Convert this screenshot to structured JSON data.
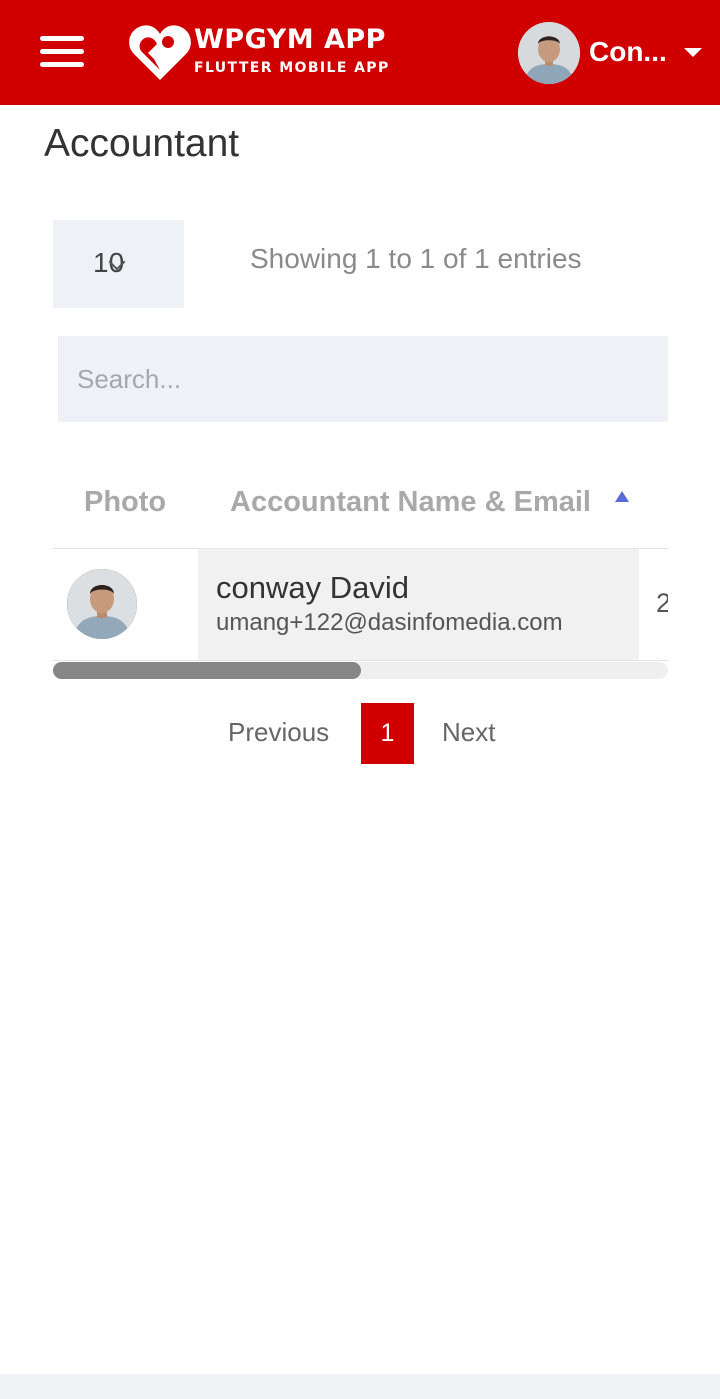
{
  "header": {
    "brand_title": "WPGYM APP",
    "brand_subtitle": "FLUTTER MOBILE APP",
    "user_name": "Con...",
    "bar_color": "#d00000"
  },
  "page": {
    "title": "Accountant"
  },
  "table_controls": {
    "entries_per_page": "10",
    "info": "Showing 1 to 1 of 1 entries",
    "search_placeholder": "Search..."
  },
  "table": {
    "columns": [
      {
        "label": "Photo"
      },
      {
        "label": "Accountant Name & Email",
        "sort": "ascending"
      }
    ],
    "rows": [
      {
        "name": "conway David",
        "email": "umang+122@dasinfomedia.com",
        "next_col_partial": "2"
      }
    ]
  },
  "pagination": {
    "previous": "Previous",
    "current": "1",
    "next": "Next"
  }
}
